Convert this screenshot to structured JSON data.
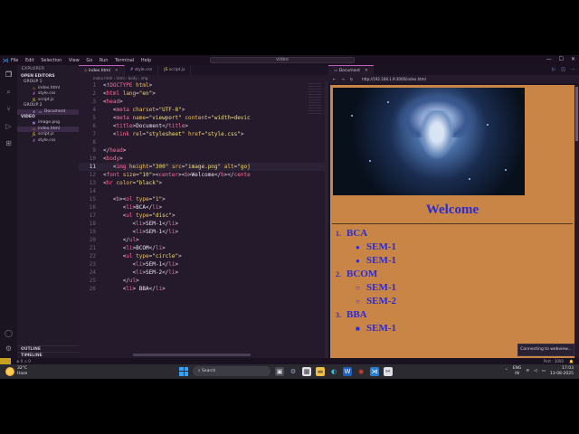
{
  "titlebar": {
    "menu": [
      "File",
      "Edit",
      "Selection",
      "View",
      "Go",
      "Run",
      "Terminal",
      "Help"
    ],
    "search": "video",
    "controls": [
      "—",
      "☐",
      "✕"
    ]
  },
  "sidebar": {
    "header": "EXPLORER",
    "open_editors": "OPEN EDITORS",
    "group1": "GROUP 1",
    "group1_files": [
      "index.html",
      "style.css",
      "script.js"
    ],
    "group2": "GROUP 2",
    "group2_files": [
      "Document"
    ],
    "folder": "VIDEO",
    "folder_files": [
      "image.png",
      "index.html",
      "script.js",
      "style.css"
    ],
    "outline": "OUTLINE",
    "timeline": "TIMELINE"
  },
  "editor": {
    "tabs": [
      "index.html",
      "style.css",
      "script.js"
    ],
    "breadcrumb": "index.html › html › body › img",
    "current_line": 11
  },
  "browser": {
    "tab": "Document",
    "url": "http://192.168.1.9:3000/index.html",
    "heading": "Welcome",
    "list": [
      {
        "marker": "1.",
        "text": "BCA",
        "level": 0
      },
      {
        "marker": "●",
        "text": "SEM-1",
        "level": 1
      },
      {
        "marker": "●",
        "text": "SEM-1",
        "level": 1
      },
      {
        "marker": "2.",
        "text": "BCOM",
        "level": 0
      },
      {
        "marker": "○",
        "text": "SEM-1",
        "level": 1
      },
      {
        "marker": "○",
        "text": "SEM-2",
        "level": 1
      },
      {
        "marker": "3.",
        "text": "BBA",
        "level": 0
      },
      {
        "marker": "■",
        "text": "SEM-1",
        "level": 1
      }
    ],
    "toast": "Connecting to webview..."
  },
  "status": {
    "left": "⊗ 0 ⚠ 0",
    "port": "Port : 3000",
    "bell": "🔔"
  },
  "taskbar": {
    "temp": "32°C",
    "weather": "Haze",
    "search": "Search",
    "lang1": "ENG",
    "lang2": "IN",
    "time": "17:03",
    "date": "13-08-2025"
  },
  "colors": {
    "page_bg": "#c98545",
    "page_text": "#2a2ad8",
    "editor_bg": "#241a2c"
  }
}
